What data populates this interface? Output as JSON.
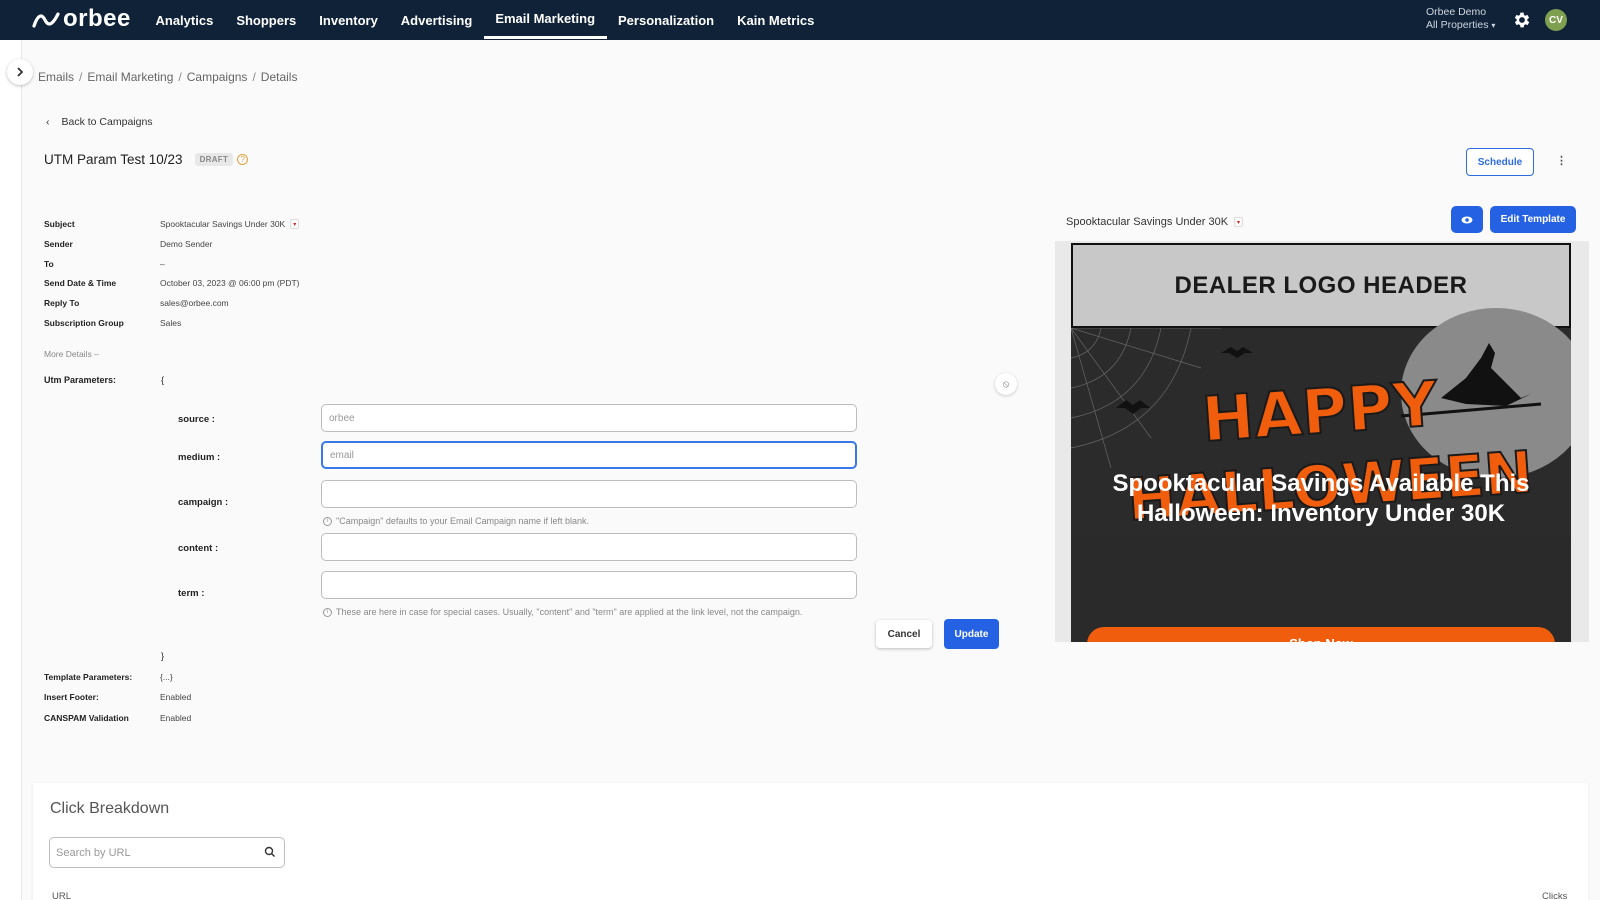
{
  "app": {
    "logo_text": "orbee",
    "nav": [
      "Analytics",
      "Shoppers",
      "Inventory",
      "Advertising",
      "Email Marketing",
      "Personalization",
      "Kain Metrics"
    ],
    "active_nav": "Email Marketing",
    "account_name": "Orbee Demo",
    "account_scope": "All Properties",
    "account_caret": "▾",
    "avatar_initials": "CV",
    "colors": {
      "nav_bg": "#0f2238",
      "primary": "#2462e3",
      "avatar": "#7fa14f",
      "shop_button": "#ef5d0d"
    }
  },
  "breadcrumb": [
    "Emails",
    "Email Marketing",
    "Campaigns",
    "Details"
  ],
  "breadcrumb_sep": "/",
  "back_link": "Back to Campaigns",
  "back_icon": "‹",
  "campaign": {
    "title": "UTM Param Test 10/23",
    "status": "DRAFT",
    "help": "?",
    "schedule_label": "Schedule",
    "kebab": "⋮"
  },
  "details": [
    {
      "label": "Subject",
      "value": "Spooktacular Savings Under 30K"
    },
    {
      "label": "Sender",
      "value": "Demo Sender"
    },
    {
      "label": "To",
      "value": "–"
    },
    {
      "label": "Send Date & Time",
      "value": "October 03, 2023 @ 06:00 pm (PDT)"
    },
    {
      "label": "Reply To",
      "value": "sales@orbee.com"
    },
    {
      "label": "Subscription Group",
      "value": "Sales"
    }
  ],
  "more_details": "More Details  –",
  "utm": {
    "label": "Utm Parameters:",
    "open_brace": "{",
    "close_brace": "}",
    "fields": [
      {
        "label": "source :",
        "placeholder": "orbee"
      },
      {
        "label": "medium :",
        "placeholder": "email"
      },
      {
        "label": "campaign :",
        "placeholder": ""
      },
      {
        "label": "content :",
        "placeholder": ""
      },
      {
        "label": "term :",
        "placeholder": ""
      }
    ],
    "campaign_hint": "\"Campaign\" defaults to your Email Campaign name if left blank.",
    "term_hint": "These are here in case for special cases. Usually, \"content\" and \"term\" are applied at the link level, not the campaign.",
    "hint_icon": "i",
    "reset_icon": "⦸",
    "cancel_label": "Cancel",
    "update_label": "Update"
  },
  "extra_details": [
    {
      "label": "Template Parameters:",
      "value": "{...}"
    },
    {
      "label": "Insert Footer:",
      "value": "Enabled"
    },
    {
      "label": "CANSPAM Validation",
      "value": "Enabled"
    }
  ],
  "preview": {
    "subject": "Spooktacular Savings Under 30K",
    "edit_label": "Edit Template",
    "eye_icon": "👁",
    "dealer_header": "DEALER LOGO HEADER",
    "hero_text_line1": "HAPPY",
    "hero_text_line2": "HALLOWEEN",
    "headline": "Spooktacular Savings Available This Halloween: Inventory Under 30K",
    "cta": "Shop Now"
  },
  "click_breakdown": {
    "title": "Click Breakdown",
    "search_placeholder": "Search by URL",
    "col_url": "URL",
    "col_clicks": "Clicks"
  },
  "flag_glyph": "▾"
}
